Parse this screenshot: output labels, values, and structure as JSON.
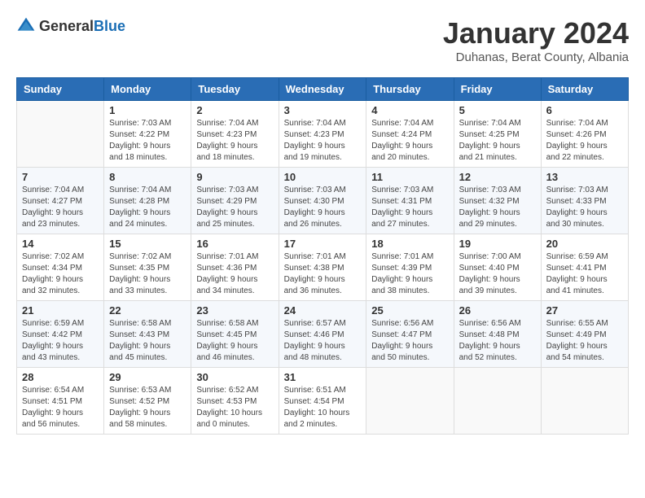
{
  "header": {
    "logo_general": "General",
    "logo_blue": "Blue",
    "title": "January 2024",
    "location": "Duhanas, Berat County, Albania"
  },
  "weekdays": [
    "Sunday",
    "Monday",
    "Tuesday",
    "Wednesday",
    "Thursday",
    "Friday",
    "Saturday"
  ],
  "weeks": [
    [
      {
        "day": "",
        "info": ""
      },
      {
        "day": "1",
        "info": "Sunrise: 7:03 AM\nSunset: 4:22 PM\nDaylight: 9 hours\nand 18 minutes."
      },
      {
        "day": "2",
        "info": "Sunrise: 7:04 AM\nSunset: 4:23 PM\nDaylight: 9 hours\nand 18 minutes."
      },
      {
        "day": "3",
        "info": "Sunrise: 7:04 AM\nSunset: 4:23 PM\nDaylight: 9 hours\nand 19 minutes."
      },
      {
        "day": "4",
        "info": "Sunrise: 7:04 AM\nSunset: 4:24 PM\nDaylight: 9 hours\nand 20 minutes."
      },
      {
        "day": "5",
        "info": "Sunrise: 7:04 AM\nSunset: 4:25 PM\nDaylight: 9 hours\nand 21 minutes."
      },
      {
        "day": "6",
        "info": "Sunrise: 7:04 AM\nSunset: 4:26 PM\nDaylight: 9 hours\nand 22 minutes."
      }
    ],
    [
      {
        "day": "7",
        "info": "Sunrise: 7:04 AM\nSunset: 4:27 PM\nDaylight: 9 hours\nand 23 minutes."
      },
      {
        "day": "8",
        "info": "Sunrise: 7:04 AM\nSunset: 4:28 PM\nDaylight: 9 hours\nand 24 minutes."
      },
      {
        "day": "9",
        "info": "Sunrise: 7:03 AM\nSunset: 4:29 PM\nDaylight: 9 hours\nand 25 minutes."
      },
      {
        "day": "10",
        "info": "Sunrise: 7:03 AM\nSunset: 4:30 PM\nDaylight: 9 hours\nand 26 minutes."
      },
      {
        "day": "11",
        "info": "Sunrise: 7:03 AM\nSunset: 4:31 PM\nDaylight: 9 hours\nand 27 minutes."
      },
      {
        "day": "12",
        "info": "Sunrise: 7:03 AM\nSunset: 4:32 PM\nDaylight: 9 hours\nand 29 minutes."
      },
      {
        "day": "13",
        "info": "Sunrise: 7:03 AM\nSunset: 4:33 PM\nDaylight: 9 hours\nand 30 minutes."
      }
    ],
    [
      {
        "day": "14",
        "info": "Sunrise: 7:02 AM\nSunset: 4:34 PM\nDaylight: 9 hours\nand 32 minutes."
      },
      {
        "day": "15",
        "info": "Sunrise: 7:02 AM\nSunset: 4:35 PM\nDaylight: 9 hours\nand 33 minutes."
      },
      {
        "day": "16",
        "info": "Sunrise: 7:01 AM\nSunset: 4:36 PM\nDaylight: 9 hours\nand 34 minutes."
      },
      {
        "day": "17",
        "info": "Sunrise: 7:01 AM\nSunset: 4:38 PM\nDaylight: 9 hours\nand 36 minutes."
      },
      {
        "day": "18",
        "info": "Sunrise: 7:01 AM\nSunset: 4:39 PM\nDaylight: 9 hours\nand 38 minutes."
      },
      {
        "day": "19",
        "info": "Sunrise: 7:00 AM\nSunset: 4:40 PM\nDaylight: 9 hours\nand 39 minutes."
      },
      {
        "day": "20",
        "info": "Sunrise: 6:59 AM\nSunset: 4:41 PM\nDaylight: 9 hours\nand 41 minutes."
      }
    ],
    [
      {
        "day": "21",
        "info": "Sunrise: 6:59 AM\nSunset: 4:42 PM\nDaylight: 9 hours\nand 43 minutes."
      },
      {
        "day": "22",
        "info": "Sunrise: 6:58 AM\nSunset: 4:43 PM\nDaylight: 9 hours\nand 45 minutes."
      },
      {
        "day": "23",
        "info": "Sunrise: 6:58 AM\nSunset: 4:45 PM\nDaylight: 9 hours\nand 46 minutes."
      },
      {
        "day": "24",
        "info": "Sunrise: 6:57 AM\nSunset: 4:46 PM\nDaylight: 9 hours\nand 48 minutes."
      },
      {
        "day": "25",
        "info": "Sunrise: 6:56 AM\nSunset: 4:47 PM\nDaylight: 9 hours\nand 50 minutes."
      },
      {
        "day": "26",
        "info": "Sunrise: 6:56 AM\nSunset: 4:48 PM\nDaylight: 9 hours\nand 52 minutes."
      },
      {
        "day": "27",
        "info": "Sunrise: 6:55 AM\nSunset: 4:49 PM\nDaylight: 9 hours\nand 54 minutes."
      }
    ],
    [
      {
        "day": "28",
        "info": "Sunrise: 6:54 AM\nSunset: 4:51 PM\nDaylight: 9 hours\nand 56 minutes."
      },
      {
        "day": "29",
        "info": "Sunrise: 6:53 AM\nSunset: 4:52 PM\nDaylight: 9 hours\nand 58 minutes."
      },
      {
        "day": "30",
        "info": "Sunrise: 6:52 AM\nSunset: 4:53 PM\nDaylight: 10 hours\nand 0 minutes."
      },
      {
        "day": "31",
        "info": "Sunrise: 6:51 AM\nSunset: 4:54 PM\nDaylight: 10 hours\nand 2 minutes."
      },
      {
        "day": "",
        "info": ""
      },
      {
        "day": "",
        "info": ""
      },
      {
        "day": "",
        "info": ""
      }
    ]
  ]
}
